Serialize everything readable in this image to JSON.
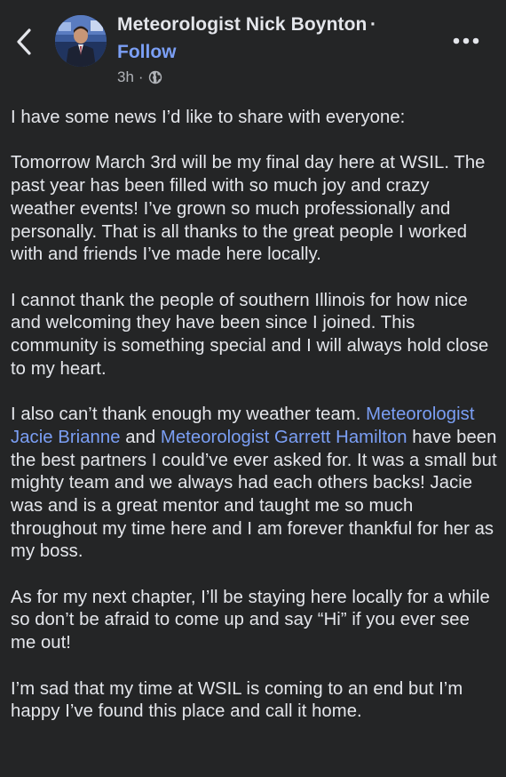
{
  "header": {
    "author_name": "Meteorologist Nick Boynton",
    "separator": "·",
    "follow_label": "Follow",
    "timestamp": "3h",
    "dot": "·",
    "privacy_icon": "globe-icon",
    "back_icon": "chevron-left-icon",
    "more_icon": "more-horizontal-icon"
  },
  "post": {
    "p1": "I have some news I’d like to share with everyone:",
    "p2": "Tomorrow March 3rd will be my final day here at WSIL. The past year has been filled with so much joy and crazy weather events! I’ve grown so much professionally and personally. That is all thanks to the great people I worked with and friends I’ve made here locally.",
    "p3": "I cannot thank the people of southern Illinois for how nice and welcoming they have been since I joined. This community is something special and I will always hold close to my heart.",
    "p4_part1": "I also can’t thank enough my weather team. ",
    "p4_link1": "Meteorologist Jacie Brianne",
    "p4_part2": " and ",
    "p4_link2": "Meteorologist Garrett Hamilton",
    "p4_part3": " have been the best partners I could’ve ever asked for. It was a small but mighty team and we always had each others backs! Jacie was and is a great mentor and taught me so much throughout my time here and I am forever thankful for her as my boss.",
    "p5": "As for my next chapter, I’ll be staying here locally for a while so don’t be afraid to come up and say “Hi” if you ever see me out!",
    "p6": "I’m sad that my time at WSIL is coming to an end but I’m happy I’ve found this place and call it home."
  },
  "colors": {
    "background": "#242526",
    "text": "#e4e6eb",
    "link": "#7b9ff5",
    "secondary": "#b0b3b8"
  }
}
